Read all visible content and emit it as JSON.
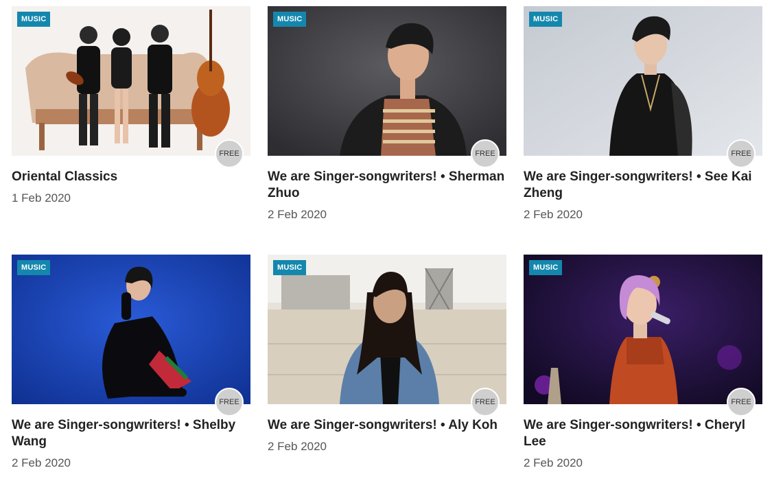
{
  "events": [
    {
      "tag": "MUSIC",
      "badge": "FREE",
      "title": "Oriental Classics",
      "date": "1 Feb 2020"
    },
    {
      "tag": "MUSIC",
      "badge": "FREE",
      "title": "We are Singer-songwriters! • Sherman Zhuo",
      "date": "2 Feb 2020"
    },
    {
      "tag": "MUSIC",
      "badge": "FREE",
      "title": "We are Singer-songwriters! • See Kai Zheng",
      "date": "2 Feb 2020"
    },
    {
      "tag": "MUSIC",
      "badge": "FREE",
      "title": "We are Singer-songwriters! • Shelby Wang",
      "date": "2 Feb 2020"
    },
    {
      "tag": "MUSIC",
      "badge": "FREE",
      "title": "We are Singer-songwriters! • Aly Koh",
      "date": "2 Feb 2020"
    },
    {
      "tag": "MUSIC",
      "badge": "FREE",
      "title": "We are Singer-songwriters! • Cheryl Lee",
      "date": "2 Feb 2020"
    }
  ]
}
